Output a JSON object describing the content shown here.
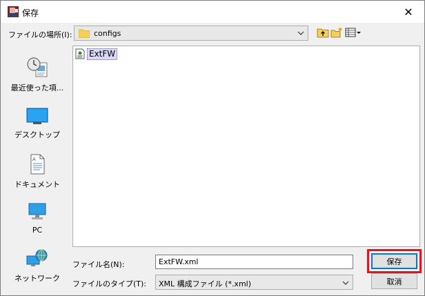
{
  "window": {
    "title": "保存",
    "close_symbol": "✕"
  },
  "lookin": {
    "label": "ファイルの場所(I):",
    "value": "configs"
  },
  "toolbar": {
    "icons": [
      "up-folder-icon",
      "new-folder-icon",
      "view-menu-icon"
    ]
  },
  "places": [
    {
      "label": "最近使った項...",
      "icon": "recent-items-icon"
    },
    {
      "label": "デスクトップ",
      "icon": "desktop-icon"
    },
    {
      "label": "ドキュメント",
      "icon": "documents-icon"
    },
    {
      "label": "PC",
      "icon": "computer-icon"
    },
    {
      "label": "ネットワーク",
      "icon": "network-icon"
    }
  ],
  "files": [
    {
      "name": "ExtFW",
      "icon": "xml-file-icon"
    }
  ],
  "filename": {
    "label": "ファイル名(N):",
    "value": "ExtFW.xml"
  },
  "filetype": {
    "label": "ファイルのタイプ(T):",
    "value": "XML 構成ファイル (*.xml)"
  },
  "buttons": {
    "save": "保存",
    "cancel": "取消"
  },
  "colors": {
    "highlight": "#e8121c",
    "selection": "#d9d9f5",
    "focus": "#0078d7"
  }
}
